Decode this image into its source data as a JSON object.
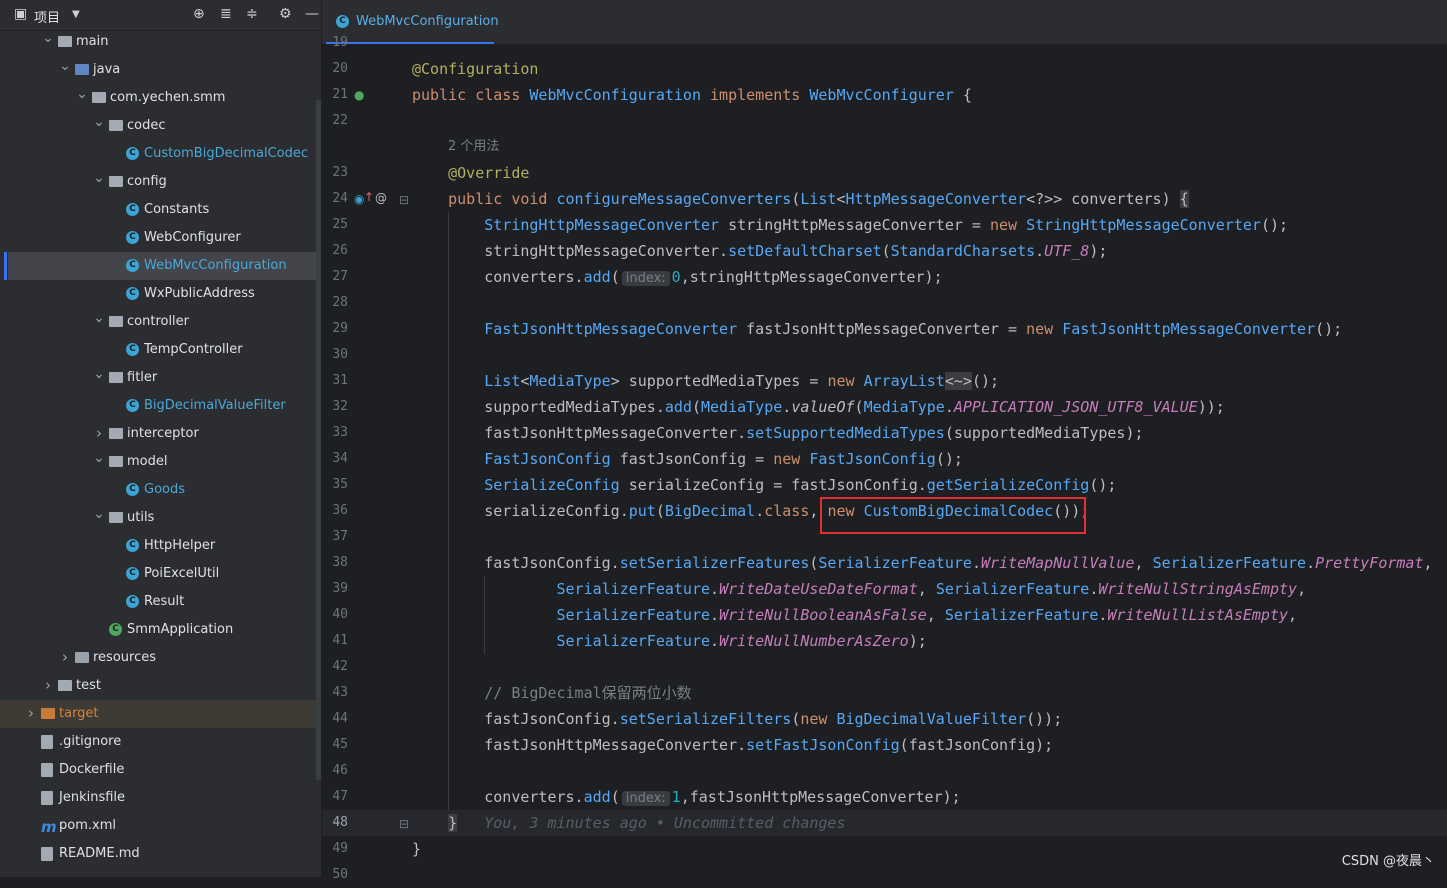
{
  "sidebar": {
    "title": "项目",
    "header_icons": [
      "crosshair-icon",
      "expand-all-icon",
      "collapse-all-icon",
      "gear-icon",
      "minimize-icon"
    ],
    "tree": [
      {
        "label": "main",
        "kind": "folder",
        "indent": 2,
        "expanded": true
      },
      {
        "label": "java",
        "kind": "folder-blue",
        "indent": 3,
        "expanded": true
      },
      {
        "label": "com.yechen.smm",
        "kind": "package",
        "indent": 4,
        "expanded": true
      },
      {
        "label": "codec",
        "kind": "package",
        "indent": 5,
        "expanded": true
      },
      {
        "label": "CustomBigDecimalCodec",
        "kind": "class",
        "indent": 6,
        "style": "blue"
      },
      {
        "label": "config",
        "kind": "package",
        "indent": 5,
        "expanded": true
      },
      {
        "label": "Constants",
        "kind": "class",
        "indent": 6
      },
      {
        "label": "WebConfigurer",
        "kind": "class",
        "indent": 6
      },
      {
        "label": "WebMvcConfiguration",
        "kind": "class",
        "indent": 6,
        "style": "blue",
        "selected": true
      },
      {
        "label": "WxPublicAddress",
        "kind": "class",
        "indent": 6
      },
      {
        "label": "controller",
        "kind": "package",
        "indent": 5,
        "expanded": true
      },
      {
        "label": "TempController",
        "kind": "class",
        "indent": 6
      },
      {
        "label": "fitler",
        "kind": "package",
        "indent": 5,
        "expanded": true
      },
      {
        "label": "BigDecimalValueFilter",
        "kind": "class",
        "indent": 6,
        "style": "blue"
      },
      {
        "label": "interceptor",
        "kind": "package",
        "indent": 5,
        "expanded": false
      },
      {
        "label": "model",
        "kind": "package",
        "indent": 5,
        "expanded": true
      },
      {
        "label": "Goods",
        "kind": "class",
        "indent": 6,
        "style": "blue"
      },
      {
        "label": "utils",
        "kind": "package",
        "indent": 5,
        "expanded": true
      },
      {
        "label": "HttpHelper",
        "kind": "class",
        "indent": 6
      },
      {
        "label": "PoiExcelUtil",
        "kind": "class",
        "indent": 6
      },
      {
        "label": "Result",
        "kind": "class",
        "indent": 6
      },
      {
        "label": "SmmApplication",
        "kind": "springclass",
        "indent": 5
      },
      {
        "label": "resources",
        "kind": "folder-res",
        "indent": 3,
        "expanded": false
      },
      {
        "label": "test",
        "kind": "folder",
        "indent": 2,
        "expanded": false
      },
      {
        "label": "target",
        "kind": "folder-orange",
        "indent": 1,
        "expanded": false,
        "style": "orange",
        "excluded": true
      },
      {
        "label": ".gitignore",
        "kind": "file",
        "indent": 1
      },
      {
        "label": "Dockerfile",
        "kind": "file",
        "indent": 1
      },
      {
        "label": "Jenkinsfile",
        "kind": "file",
        "indent": 1
      },
      {
        "label": "pom.xml",
        "kind": "maven",
        "indent": 1
      },
      {
        "label": "README.md",
        "kind": "file",
        "indent": 1
      }
    ]
  },
  "editor": {
    "tab_label": "WebMvcConfiguration",
    "usages_hint": "2 个用法",
    "blame": "You, 3 minutes ago • Uncommitted changes",
    "param_hint": "index:",
    "line_numbers": [
      "19",
      "20",
      "21",
      "22",
      "",
      "23",
      "24",
      "25",
      "26",
      "27",
      "28",
      "29",
      "30",
      "31",
      "32",
      "33",
      "34",
      "35",
      "36",
      "37",
      "38",
      "39",
      "40",
      "41",
      "42",
      "43",
      "44",
      "45",
      "46",
      "47",
      "48",
      "49",
      "50"
    ],
    "current_line": "48"
  },
  "colors": {
    "accent": "#3574f0",
    "highlight_box": "#e03131",
    "keyword": "#cf8e6d",
    "type": "#56a8f5",
    "annotation": "#b3ae60"
  },
  "watermark": "CSDN @夜晨丶"
}
